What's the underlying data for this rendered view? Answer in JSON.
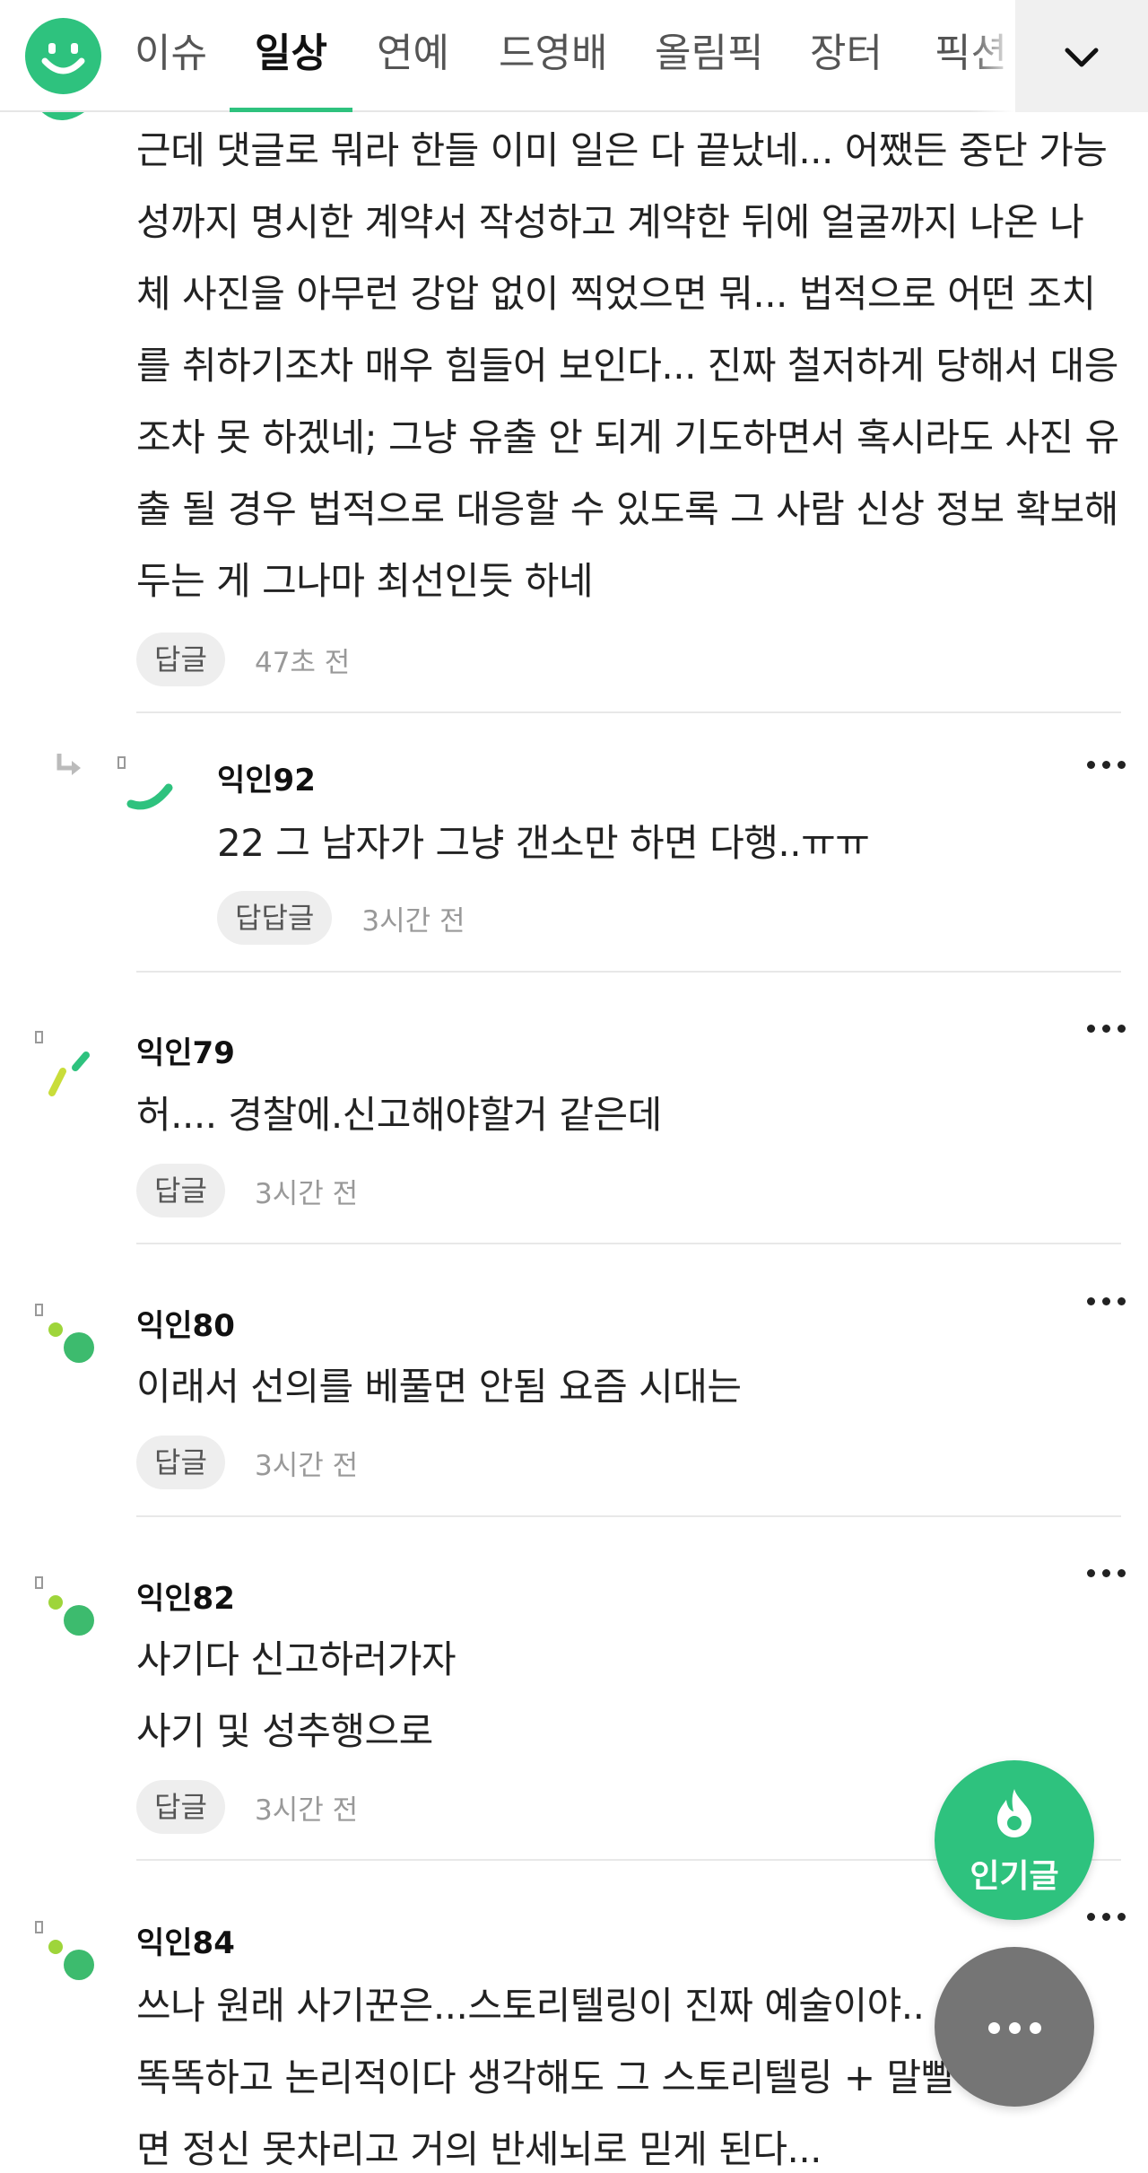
{
  "nav": {
    "tabs": [
      "이슈",
      "일상",
      "연예",
      "드영배",
      "올림픽",
      "장터",
      "픽션"
    ],
    "active_tab": "일상",
    "expand_icon": "chevron-down-icon",
    "accent_color": "#2ec27e"
  },
  "comments": [
    {
      "lines": [
        "근데 댓글로 뭐라 한들 이미 일은 다 끝났네... 어쨌든 중단 가능",
        "성까지 명시한 계약서 작성하고 계약한 뒤에 얼굴까지 나온 나",
        "체 사진을 아무런 강압 없이 찍었으면 뭐... 법적으로 어떤 조치",
        "를 취하기조차 매우 힘들어 보인다... 진짜 철저하게 당해서 대응",
        "조차 못 하겠네; 그냥 유출 안 되게 기도하면서 혹시라도 사진 유",
        "출 될 경우 법적으로 대응할 수 있도록 그 사람 신상 정보 확보해",
        "두는 게 그나마 최선인듯 하네"
      ],
      "reply_label": "답글",
      "time": "47초 전"
    },
    {
      "author": "익인92",
      "lines": [
        "22 그 남자가 그냥 갠소만 하면 다행..ㅠㅠ"
      ],
      "reply_label": "답답글",
      "time": "3시간 전"
    },
    {
      "author": "익인79",
      "lines": [
        "허.... 경찰에.신고해야할거 같은데"
      ],
      "reply_label": "답글",
      "time": "3시간 전"
    },
    {
      "author": "익인80",
      "lines": [
        "이래서 선의를 베풀면 안됨 요즘 시대는"
      ],
      "reply_label": "답글",
      "time": "3시간 전"
    },
    {
      "author": "익인82",
      "lines": [
        "사기다 신고하러가자",
        "사기 및 성추행으로"
      ],
      "reply_label": "답글",
      "time": "3시간 전"
    },
    {
      "author": "익인84",
      "lines": [
        "쓰나 원래 사기꾼은...스토리텔링이 진짜 예술이야..",
        "똑똑하고 논리적이다 생각해도 그 스토리텔링 + 말빨",
        "면 정신 못차리고 거의 반세뇌로 믿게 된다..."
      ]
    }
  ],
  "fab": {
    "popular_label": "인기글",
    "popular_icon": "fire-icon",
    "more_icon": "more-icon"
  }
}
